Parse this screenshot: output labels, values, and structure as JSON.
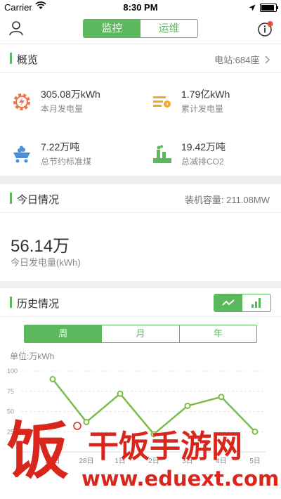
{
  "status": {
    "carrier": "Carrier",
    "time": "8:30 PM"
  },
  "nav": {
    "tab_monitor": "监控",
    "tab_ops": "运维"
  },
  "overview": {
    "title": "概览",
    "stations": "电站:684座",
    "items": [
      {
        "value": "305.08万kWh",
        "label": "本月发电量",
        "icon": "gear-bolt-icon",
        "color": "#f0734a"
      },
      {
        "value": "1.79亿kWh",
        "label": "累计发电量",
        "icon": "stack-bolt-icon",
        "color": "#f5a623"
      },
      {
        "value": "7.22万吨",
        "label": "总节约标准煤",
        "icon": "coal-cart-icon",
        "color": "#4a90d9"
      },
      {
        "value": "19.42万吨",
        "label": "总减排CO2",
        "icon": "factory-icon",
        "color": "#5cb85c"
      }
    ]
  },
  "today": {
    "title": "今日情况",
    "capacity": "装机容量: 211.08MW",
    "value": "56.14万",
    "label": "今日发电量(kWh)"
  },
  "history": {
    "title": "历史情况",
    "periods": [
      "周",
      "月",
      "年"
    ],
    "unit": "单位:万kWh"
  },
  "chart_data": {
    "type": "line",
    "ylim": [
      0,
      100
    ],
    "yticks": [
      "100",
      "75",
      "50",
      "25"
    ],
    "categories": [
      "27日",
      "28日",
      "1日",
      "2日",
      "3日",
      "4日",
      "5日"
    ],
    "values": [
      90,
      37,
      72,
      22,
      57,
      68,
      25
    ],
    "color": "#7cbd4a",
    "grid": true
  },
  "watermark": {
    "brand": "干饭手游网",
    "glyph": "饭",
    "url": "www.eduext.com"
  }
}
